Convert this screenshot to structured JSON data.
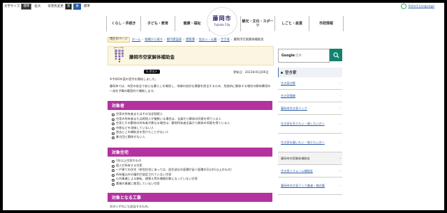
{
  "topbar": {
    "font_size_label": "文字サイズ",
    "font_std": "標準",
    "font_large": "拡大",
    "color_label": "背景色変更",
    "color_black": "黒",
    "color_blue": "青",
    "color_std": "標準",
    "language": "Select Language"
  },
  "nav": {
    "left": [
      "くらし・手続き",
      "子ども・教育",
      "健康・福祉"
    ],
    "right": [
      "観光・文化・スポーツ",
      "しごと・産業",
      "市政情報"
    ]
  },
  "logo": {
    "kanji": "藤岡市",
    "roman": "Fujioka City"
  },
  "breadcrumb": {
    "current_label": "現在のページ",
    "items": [
      "ホーム",
      "組織から探す",
      "都市建設部",
      "建築課",
      "住まい・公園",
      "空き家",
      "藤岡市空家解体補助金"
    ]
  },
  "page": {
    "title": "藤岡市空家解体補助金",
    "share_x": "ポスト",
    "share_other": "",
    "updated": "更新日：2023年01月06日",
    "notice": "※令和5年度の受付を開始しました。",
    "intro": "藤岡市では、市民の安全で安心な暮らしを確保し、地域の良好な景観を保全するため、危険的に解体する場合の解体費用の一部を予算の範囲内で補助します。"
  },
  "sections": [
    {
      "heading": "対象者",
      "items": [
        "空家の所有者またはその法定相続人",
        "空家の所有者または相続人が複数いる場合は、全員から解体の同意を得ている人",
        "空家とその敷地の所有者が異なる場合は、敷地所有者全員から解体の同意を得ている人",
        "市税などを滞納していない人",
        "過去にこの補助金を受けたことがない人",
        "暴力団と関係がない人"
      ]
    },
    {
      "heading": "対象住宅",
      "items": [
        "1年以上空家のもの",
        "個人が所有する空家",
        "一戸建ての住宅（併用住宅にあっては、居住部分の面積が延べ面積の2分の1以上のもの）",
        "所有権以外の権利が設定されていない空家",
        "公共事業による移転、建替え等の補償対象になっていない空家",
        "賃貸の事業に使用していない空家"
      ]
    },
    {
      "heading": "対象となる工事",
      "items": []
    }
  ],
  "work_note": "次のいずれにも該当するもの。",
  "search": {
    "brand": "Google",
    "suffix": "提供"
  },
  "sidebar": {
    "heading": "空き家",
    "items": [
      "空き家対策",
      "空き家情報",
      "藤岡市空き家バンク",
      "空き家を売りたい・貸したい方へ",
      "空き家を買いたい・借りたい方へ",
      "藤岡市空家解体補助金",
      "空き家リフォーム補助金",
      "藤岡市空き家バンク業者・様式集"
    ],
    "active_index": 5
  },
  "colors": {
    "accent": "#b3329f",
    "search_button": "#13826f",
    "link": "#2b5ea7"
  }
}
